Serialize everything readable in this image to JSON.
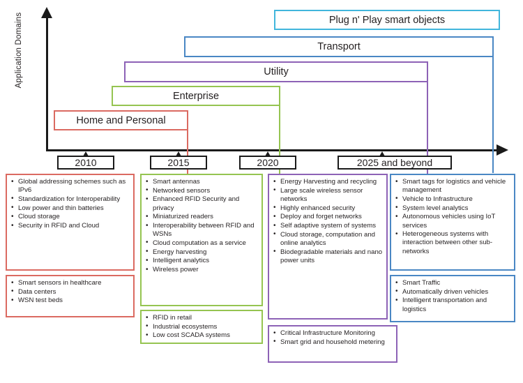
{
  "axis": {
    "y_label": "Application Domains",
    "y_axis_name": "vertical-axis",
    "x_axis_name": "timeline-axis"
  },
  "timeline": {
    "ticks": [
      {
        "label": "2010"
      },
      {
        "label": "2015"
      },
      {
        "label": "2020"
      },
      {
        "label": "2025 and beyond"
      }
    ]
  },
  "domains": [
    {
      "label": "Plug n' Play smart objects",
      "color": "#41B6DC"
    },
    {
      "label": "Transport",
      "color": "#4A87C4"
    },
    {
      "label": "Utility",
      "color": "#8D62B6"
    },
    {
      "label": "Enterprise",
      "color": "#95C451"
    },
    {
      "label": "Home and Personal",
      "color": "#DB6A61"
    }
  ],
  "cards": {
    "home_primary": {
      "color": "#DB6A61",
      "items": [
        "Global addressing schemes such as IPv6",
        "Standardization for Interoperability",
        "Low power and thin batteries",
        "Cloud storage",
        "Security in RFID and Cloud"
      ]
    },
    "home_secondary": {
      "color": "#DB6A61",
      "items": [
        "Smart sensors in healthcare",
        "Data centers",
        "WSN test beds"
      ]
    },
    "enterprise_primary": {
      "color": "#95C451",
      "items": [
        "Smart antennas",
        "Networked sensors",
        "Enhanced RFID Security and privacy",
        "Miniaturized readers",
        "Interoperability between RFID and WSNs",
        "Cloud computation as a service",
        "Energy harvesting",
        "Intelligent analytics",
        "Wireless power"
      ]
    },
    "enterprise_secondary": {
      "color": "#95C451",
      "items": [
        "RFID in retail",
        "Industrial ecosystems",
        "Low cost SCADA systems"
      ]
    },
    "utility_primary": {
      "color": "#8D62B6",
      "items": [
        "Energy Harvesting and recycling",
        "Large scale wireless sensor  networks",
        "Highly enhanced security",
        "Deploy and forget networks",
        "Self adaptive system of systems",
        "Cloud storage, computation and online analytics",
        "Biodegradable materials and nano power units"
      ]
    },
    "utility_secondary": {
      "color": "#8D62B6",
      "items": [
        "Critical Infrastructure Monitoring",
        "Smart grid and household metering"
      ]
    },
    "transport_primary": {
      "color": "#4A87C4",
      "items": [
        "Smart tags for logistics and vehicle management",
        "Vehicle to Infrastructure",
        "System level analytics",
        "Autonomous vehicles using IoT services",
        "Heterogeneous systems with interaction between other sub-networks"
      ]
    },
    "transport_secondary": {
      "color": "#4A87C4",
      "items": [
        "Smart Traffic",
        "Automatically driven vehicles",
        "Intelligent transportation and logistics"
      ]
    }
  }
}
